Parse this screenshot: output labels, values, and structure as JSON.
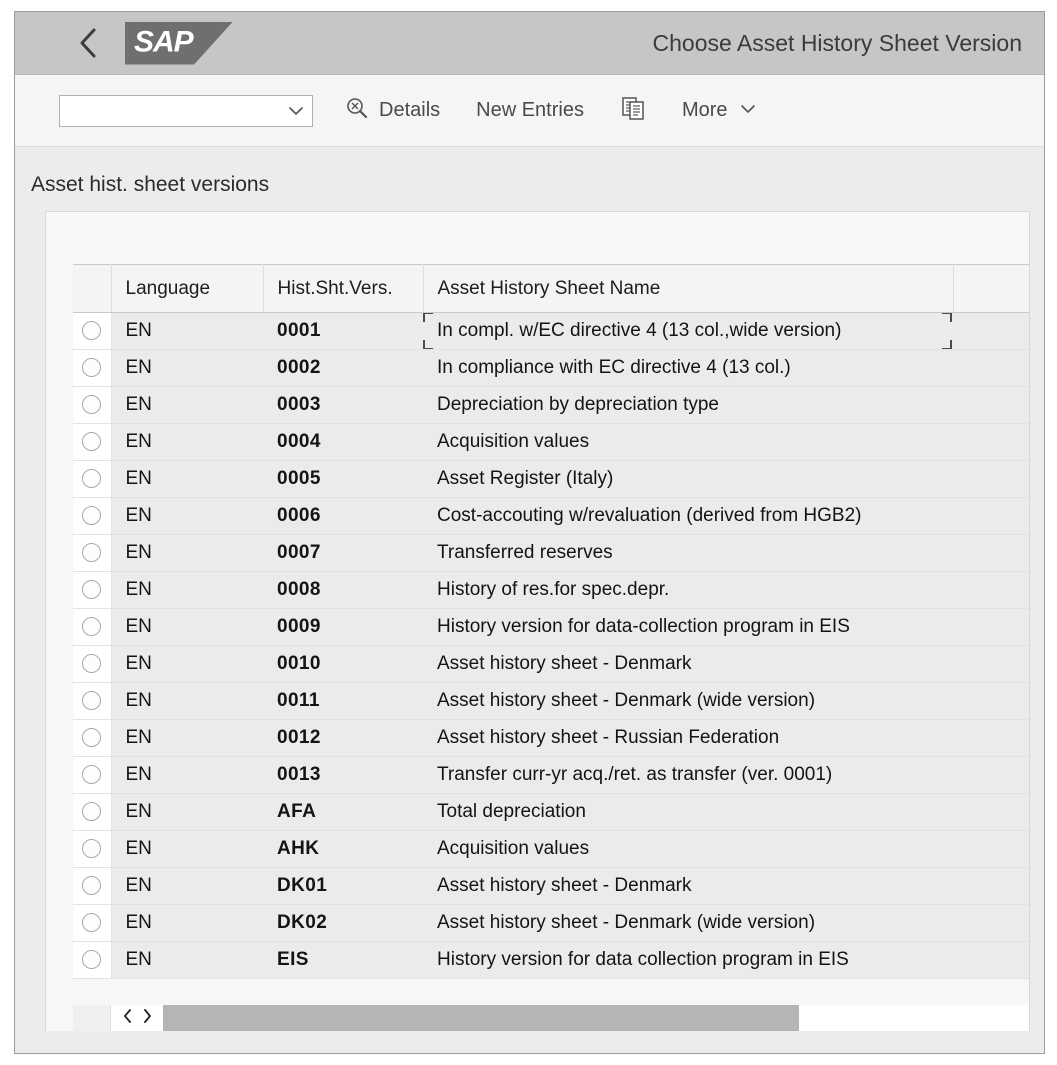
{
  "window": {
    "header": {
      "back_icon": "chevron-left-icon",
      "logo_text": "SAP",
      "title": "Choose Asset History Sheet Version"
    },
    "toolbar": {
      "select_value": "",
      "select_placeholder": "",
      "select_chevron_icon": "chevron-down-icon",
      "details_label": "Details",
      "details_icon": "magnifier-detail-icon",
      "new_entries_label": "New Entries",
      "copy_icon": "copy-document-icon",
      "more_label": "More",
      "more_chevron_icon": "chevron-down-icon"
    },
    "content": {
      "section_title": "Asset hist. sheet versions",
      "table": {
        "columns": [
          "",
          "Language",
          "Hist.Sht.Vers.",
          "Asset History Sheet Name",
          ""
        ],
        "rows": [
          {
            "lang": "EN",
            "vers": "0001",
            "name": "In compl. w/EC directive 4 (13 col.,wide version)",
            "focused": true
          },
          {
            "lang": "EN",
            "vers": "0002",
            "name": "In compliance with EC directive 4 (13 col.)"
          },
          {
            "lang": "EN",
            "vers": "0003",
            "name": "Depreciation by depreciation type"
          },
          {
            "lang": "EN",
            "vers": "0004",
            "name": "Acquisition values"
          },
          {
            "lang": "EN",
            "vers": "0005",
            "name": "Asset Register (Italy)"
          },
          {
            "lang": "EN",
            "vers": "0006",
            "name": "Cost-accouting w/revaluation (derived from HGB2)"
          },
          {
            "lang": "EN",
            "vers": "0007",
            "name": "Transferred reserves"
          },
          {
            "lang": "EN",
            "vers": "0008",
            "name": "History of res.for spec.depr."
          },
          {
            "lang": "EN",
            "vers": "0009",
            "name": "History version for data-collection program in EIS"
          },
          {
            "lang": "EN",
            "vers": "0010",
            "name": "Asset history sheet - Denmark"
          },
          {
            "lang": "EN",
            "vers": "0011",
            "name": "Asset history sheet - Denmark (wide version)"
          },
          {
            "lang": "EN",
            "vers": "0012",
            "name": "Asset history sheet - Russian Federation"
          },
          {
            "lang": "EN",
            "vers": "0013",
            "name": "Transfer curr-yr acq./ret. as transfer (ver. 0001)"
          },
          {
            "lang": "EN",
            "vers": "AFA",
            "name": "Total depreciation"
          },
          {
            "lang": "EN",
            "vers": "AHK",
            "name": "Acquisition values"
          },
          {
            "lang": "EN",
            "vers": "DK01",
            "name": "Asset history sheet - Denmark"
          },
          {
            "lang": "EN",
            "vers": "DK02",
            "name": "Asset history sheet - Denmark (wide version)"
          },
          {
            "lang": "EN",
            "vers": "EIS",
            "name": "History version for data collection program in EIS"
          }
        ]
      },
      "scrollbar": {
        "left_arrow_icon": "chevron-left-icon",
        "right_arrow_icon": "chevron-right-icon"
      }
    }
  },
  "colors": {
    "header_bg": "#c6c6c6",
    "row_bg": "#ebebeb",
    "scroll_thumb": "#b5b5b5",
    "logo_bg": "#6f6f6f"
  }
}
